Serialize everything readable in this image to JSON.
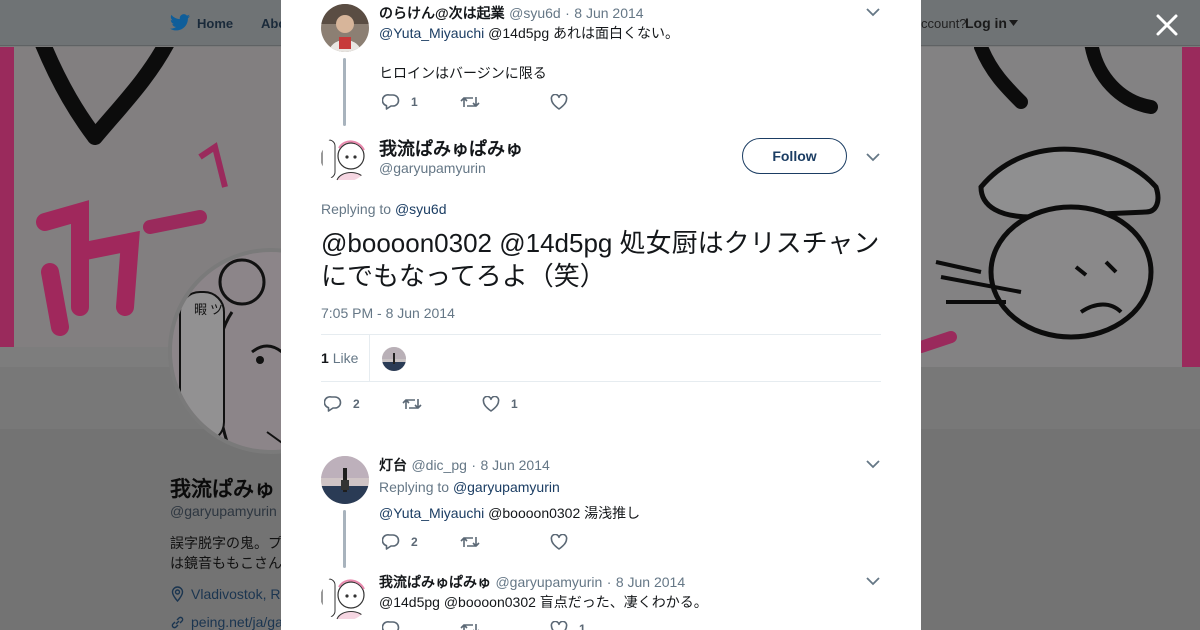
{
  "nav": {
    "home_label": "Home",
    "about_label": "Abo",
    "account_text": "ccount?",
    "login_label": "Log in"
  },
  "profile": {
    "name": "我流ぱみゅ",
    "handle": "@garyupamyurin",
    "bio_line1": "誤字脱字の鬼。プ",
    "bio_line2": "は鏡音ももこさん",
    "location": "Vladivostok, R",
    "link": "peing.net/ja/ga"
  },
  "thread": {
    "parent": {
      "name": "のらけん@次は起業",
      "handle": "@syu6d",
      "dot": "·",
      "time": "8 Jun 2014",
      "mention": "@Yuta_Miyauchi",
      "text_line1": "@14d5pg あれは面白くない。",
      "text_line2": "ヒロインはバージンに限る",
      "reply_count": "1",
      "retweet_count": "",
      "like_count": ""
    },
    "main": {
      "name": "我流ぱみゅぱみゅ",
      "handle": "@garyupamyurin",
      "follow_label": "Follow",
      "replying_prefix": "Replying to",
      "replying_to": "@syu6d",
      "text": "@boooon0302 @14d5pg 処女厨はクリスチャンにでもなってろよ（笑）",
      "timestamp": "7:05 PM - 8 Jun 2014",
      "likes_count": "1",
      "likes_label": "Like",
      "reply_count": "2",
      "retweet_count": "",
      "like_count": "1"
    },
    "reply1": {
      "name": "灯台",
      "handle": "@dic_pg",
      "dot": "·",
      "time": "8 Jun 2014",
      "replying_prefix": "Replying to",
      "replying_to": "@garyupamyurin",
      "mention": "@Yuta_Miyauchi",
      "text": "@boooon0302 湯浅推し",
      "reply_count": "2",
      "retweet_count": "",
      "like_count": ""
    },
    "reply2": {
      "name": "我流ぱみゅぱみゅ",
      "handle": "@garyupamyurin",
      "dot": "·",
      "time": "8 Jun 2014",
      "text": "@14d5pg @boooon0302 盲点だった、凄くわかる。",
      "like_count": "1"
    }
  },
  "colors": {
    "accent": "#1b3d63",
    "muted": "#657786",
    "divider": "#e6ecf0",
    "overlay": "#7a7a7a",
    "banner_pink": "#d81b72"
  },
  "icons": [
    "twitter-bird-icon",
    "close-icon",
    "chevron-down-icon",
    "reply-icon",
    "retweet-icon",
    "heart-icon",
    "location-pin-icon",
    "link-icon"
  ]
}
